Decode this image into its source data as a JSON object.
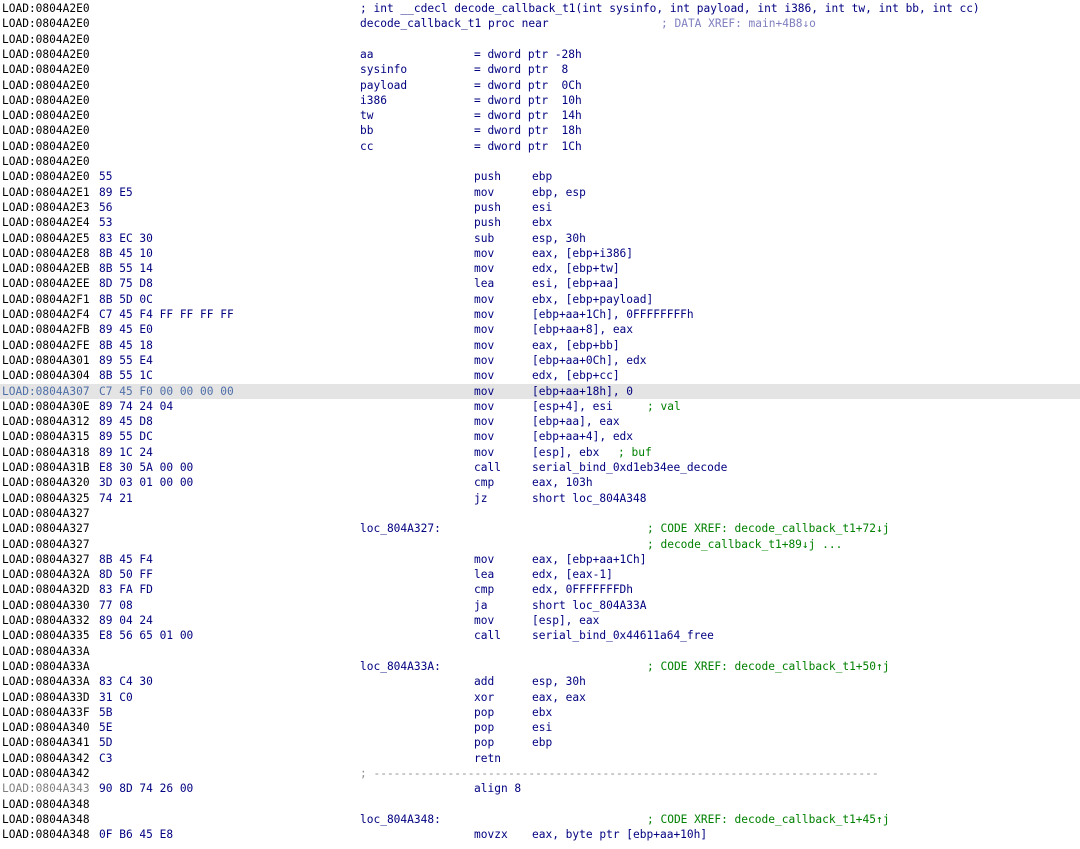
{
  "header": {
    "signature_comment": "; int __cdecl decode_callback_t1(int sysinfo, int payload, int i386, int tw, int bb, int cc)",
    "proc_decl": "decode_callback_t1 proc near",
    "proc_xref": "; DATA XREF: main+4B8↓o"
  },
  "lines": [
    {
      "addr": "LOAD:0804A2E0",
      "kind": "header"
    },
    {
      "addr": "LOAD:0804A2E0",
      "kind": "proc"
    },
    {
      "addr": "LOAD:0804A2E0"
    },
    {
      "addr": "LOAD:0804A2E0",
      "var": "aa",
      "def": "= dword ptr -28h"
    },
    {
      "addr": "LOAD:0804A2E0",
      "var": "sysinfo",
      "def": "= dword ptr  8"
    },
    {
      "addr": "LOAD:0804A2E0",
      "var": "payload",
      "def": "= dword ptr  0Ch"
    },
    {
      "addr": "LOAD:0804A2E0",
      "var": "i386",
      "def": "= dword ptr  10h"
    },
    {
      "addr": "LOAD:0804A2E0",
      "var": "tw",
      "def": "= dword ptr  14h"
    },
    {
      "addr": "LOAD:0804A2E0",
      "var": "bb",
      "def": "= dword ptr  18h"
    },
    {
      "addr": "LOAD:0804A2E0",
      "var": "cc",
      "def": "= dword ptr  1Ch"
    },
    {
      "addr": "LOAD:0804A2E0"
    },
    {
      "addr": "LOAD:0804A2E0",
      "bytes": "55",
      "mn": "push",
      "op": "ebp"
    },
    {
      "addr": "LOAD:0804A2E1",
      "bytes": "89 E5",
      "mn": "mov",
      "op": "ebp, esp"
    },
    {
      "addr": "LOAD:0804A2E3",
      "bytes": "56",
      "mn": "push",
      "op": "esi"
    },
    {
      "addr": "LOAD:0804A2E4",
      "bytes": "53",
      "mn": "push",
      "op": "ebx"
    },
    {
      "addr": "LOAD:0804A2E5",
      "bytes": "83 EC 30",
      "mn": "sub",
      "op": "esp, 30h"
    },
    {
      "addr": "LOAD:0804A2E8",
      "bytes": "8B 45 10",
      "mn": "mov",
      "op": "eax, [ebp+i386]"
    },
    {
      "addr": "LOAD:0804A2EB",
      "bytes": "8B 55 14",
      "mn": "mov",
      "op": "edx, [ebp+tw]"
    },
    {
      "addr": "LOAD:0804A2EE",
      "bytes": "8D 75 D8",
      "mn": "lea",
      "op": "esi, [ebp+aa]"
    },
    {
      "addr": "LOAD:0804A2F1",
      "bytes": "8B 5D 0C",
      "mn": "mov",
      "op": "ebx, [ebp+payload]"
    },
    {
      "addr": "LOAD:0804A2F4",
      "bytes": "C7 45 F4 FF FF FF FF",
      "mn": "mov",
      "op": "[ebp+aa+1Ch], 0FFFFFFFFh"
    },
    {
      "addr": "LOAD:0804A2FB",
      "bytes": "89 45 E0",
      "mn": "mov",
      "op": "[ebp+aa+8], eax"
    },
    {
      "addr": "LOAD:0804A2FE",
      "bytes": "8B 45 18",
      "mn": "mov",
      "op": "eax, [ebp+bb]"
    },
    {
      "addr": "LOAD:0804A301",
      "bytes": "89 55 E4",
      "mn": "mov",
      "op": "[ebp+aa+0Ch], edx"
    },
    {
      "addr": "LOAD:0804A304",
      "bytes": "8B 55 1C",
      "mn": "mov",
      "op": "edx, [ebp+cc]"
    },
    {
      "addr": "LOAD:0804A307",
      "bytes": "C7 45 F0 00 00 00 00",
      "mn": "mov",
      "op": "[ebp+aa+18h], 0",
      "highlight": true
    },
    {
      "addr": "LOAD:0804A30E",
      "bytes": "89 74 24 04",
      "mn": "mov",
      "op": "[esp+4], esi",
      "cmt": "; val"
    },
    {
      "addr": "LOAD:0804A312",
      "bytes": "89 45 D8",
      "mn": "mov",
      "op": "[ebp+aa], eax"
    },
    {
      "addr": "LOAD:0804A315",
      "bytes": "89 55 DC",
      "mn": "mov",
      "op": "[ebp+aa+4], edx"
    },
    {
      "addr": "LOAD:0804A318",
      "bytes": "89 1C 24",
      "mn": "mov",
      "op": "[esp], ebx",
      "cmt": "; buf"
    },
    {
      "addr": "LOAD:0804A31B",
      "bytes": "E8 30 5A 00 00",
      "mn": "call",
      "op": "serial_bind_0xd1eb34ee_decode"
    },
    {
      "addr": "LOAD:0804A320",
      "bytes": "3D 03 01 00 00",
      "mn": "cmp",
      "op": "eax, 103h"
    },
    {
      "addr": "LOAD:0804A325",
      "bytes": "74 21",
      "mn": "jz",
      "op": "short loc_804A348"
    },
    {
      "addr": "LOAD:0804A327"
    },
    {
      "addr": "LOAD:0804A327",
      "label": "loc_804A327:",
      "xref": "; CODE XREF: decode_callback_t1+72↓j"
    },
    {
      "addr": "LOAD:0804A327",
      "xref": "; decode_callback_t1+89↓j ..."
    },
    {
      "addr": "LOAD:0804A327",
      "bytes": "8B 45 F4",
      "mn": "mov",
      "op": "eax, [ebp+aa+1Ch]"
    },
    {
      "addr": "LOAD:0804A32A",
      "bytes": "8D 50 FF",
      "mn": "lea",
      "op": "edx, [eax-1]"
    },
    {
      "addr": "LOAD:0804A32D",
      "bytes": "83 FA FD",
      "mn": "cmp",
      "op": "edx, 0FFFFFFFDh"
    },
    {
      "addr": "LOAD:0804A330",
      "bytes": "77 08",
      "mn": "ja",
      "op": "short loc_804A33A"
    },
    {
      "addr": "LOAD:0804A332",
      "bytes": "89 04 24",
      "mn": "mov",
      "op": "[esp], eax"
    },
    {
      "addr": "LOAD:0804A335",
      "bytes": "E8 56 65 01 00",
      "mn": "call",
      "op": "serial_bind_0x44611a64_free"
    },
    {
      "addr": "LOAD:0804A33A"
    },
    {
      "addr": "LOAD:0804A33A",
      "label": "loc_804A33A:",
      "xref": "; CODE XREF: decode_callback_t1+50↑j"
    },
    {
      "addr": "LOAD:0804A33A",
      "bytes": "83 C4 30",
      "mn": "add",
      "op": "esp, 30h"
    },
    {
      "addr": "LOAD:0804A33D",
      "bytes": "31 C0",
      "mn": "xor",
      "op": "eax, eax"
    },
    {
      "addr": "LOAD:0804A33F",
      "bytes": "5B",
      "mn": "pop",
      "op": "ebx"
    },
    {
      "addr": "LOAD:0804A340",
      "bytes": "5E",
      "mn": "pop",
      "op": "esi"
    },
    {
      "addr": "LOAD:0804A341",
      "bytes": "5D",
      "mn": "pop",
      "op": "ebp"
    },
    {
      "addr": "LOAD:0804A342",
      "bytes": "C3",
      "mn": "retn",
      "op": ""
    },
    {
      "addr": "LOAD:0804A342",
      "separator": "; ---------------------------------------------------------------------------"
    },
    {
      "addr": "LOAD:0804A343",
      "bytes": "90 8D 74 26 00",
      "mn": "align 8",
      "op": "",
      "grey": true
    },
    {
      "addr": "LOAD:0804A348"
    },
    {
      "addr": "LOAD:0804A348",
      "label": "loc_804A348:",
      "xref": "; CODE XREF: decode_callback_t1+45↑j"
    },
    {
      "addr": "LOAD:0804A348",
      "bytes": "0F B6 45 E8",
      "mn": "movzx",
      "op": "eax, byte ptr [ebp+aa+10h]"
    }
  ]
}
